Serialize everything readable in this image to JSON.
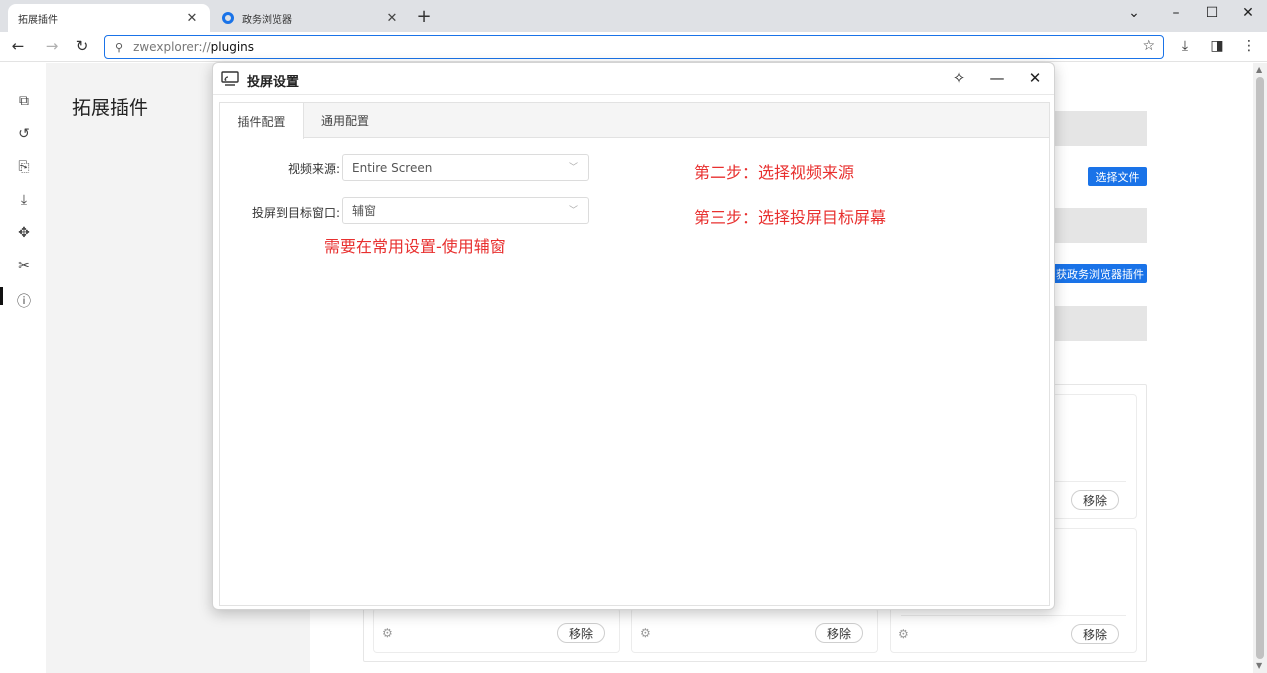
{
  "browser": {
    "tabs": [
      {
        "title": "拓展插件",
        "active": true
      },
      {
        "title": "政务浏览器",
        "active": false
      }
    ],
    "url_scheme": "zwexplorer://",
    "url_path": "plugins"
  },
  "page": {
    "heading": "拓展插件",
    "choose_file_label": "选择文件",
    "get_plugins_label": "获政务浏览器插件",
    "remove_label": "移除"
  },
  "dialog": {
    "title": "投屏设置",
    "tabs": [
      "插件配置",
      "通用配置"
    ],
    "source_label": "视频来源:",
    "source_value": "Entire Screen",
    "target_label": "投屏到目标窗口:",
    "target_value": "辅窗",
    "annotations": {
      "step2": "第二步：选择视频来源",
      "step3": "第三步：选择投屏目标屏幕",
      "note": "需要在常用设置-使用辅窗"
    }
  },
  "colors": {
    "accent": "#1a73e8",
    "annotation": "#e8302f"
  }
}
